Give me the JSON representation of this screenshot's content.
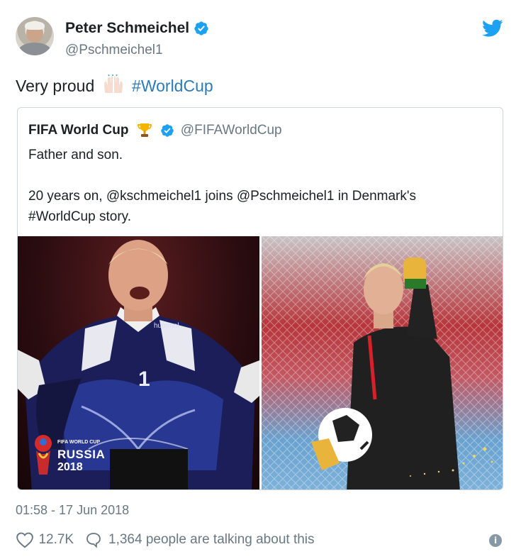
{
  "author": {
    "name": "Peter Schmeichel",
    "handle": "@Pschmeichel1",
    "verified": true,
    "avatar_icon": "profile-photo"
  },
  "tweet": {
    "text_before": "Very proud",
    "emoji": "raised-hands-emoji",
    "hashtag": "#WorldCup"
  },
  "quoted_tweet": {
    "name": "FIFA World Cup",
    "handle": "@FIFAWorldCup",
    "verified": true,
    "name_emoji": "trophy-emoji",
    "line1": "Father and son.",
    "line2": "20 years on, @kschmeichel1 joins @Pschmeichel1 in Denmark's",
    "line3": "#WorldCup story.",
    "media": {
      "left_alt": "goalkeeper-in-denmark-kit-1998",
      "right_alt": "goalkeeper-with-ball-thumbs-up-2018",
      "logo_small": "FIFA WORLD CUP",
      "logo_big": "RUSSIA",
      "logo_year": "2018",
      "jersey_number": "1",
      "jersey_brand": "hummel"
    }
  },
  "timestamp": "01:58 - 17 Jun 2018",
  "actions": {
    "likes": "12.7K",
    "talking": "1,364 people are talking about this",
    "info_glyph": "i"
  },
  "colors": {
    "link": "#2b7bb9",
    "verified": "#1da1f2",
    "muted": "#697882",
    "border": "#ccd6dd"
  }
}
